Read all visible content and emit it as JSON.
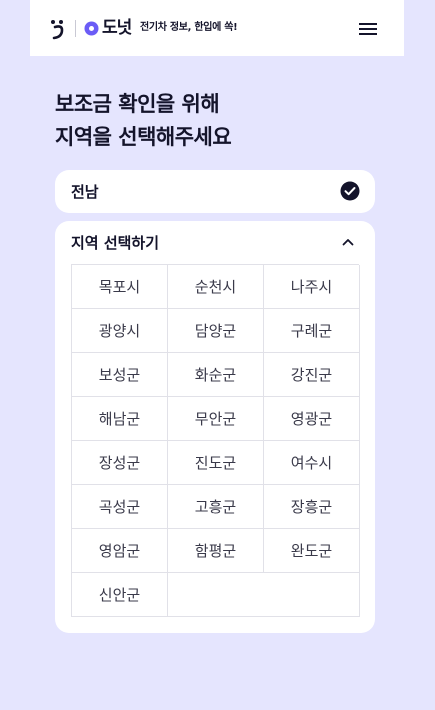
{
  "header": {
    "brand_name": "도넛",
    "slogan": "전기차 정보, 한입에 쏙!",
    "logo_icon": "donut-logo-icon",
    "menu_icon": "hamburger-menu-icon"
  },
  "page": {
    "title_line1": "보조금 확인을 위해",
    "title_line2": "지역을 선택해주세요"
  },
  "province": {
    "selected": "전남",
    "icon": "check-circle-icon"
  },
  "region_select": {
    "title": "지역 선택하기",
    "expanded": true,
    "chevron_icon": "chevron-up-icon",
    "regions": [
      "목포시",
      "순천시",
      "나주시",
      "광양시",
      "담양군",
      "구례군",
      "보성군",
      "화순군",
      "강진군",
      "해남군",
      "무안군",
      "영광군",
      "장성군",
      "진도군",
      "여수시",
      "곡성군",
      "고흥군",
      "장흥군",
      "영암군",
      "함평군",
      "완도군",
      "신안군"
    ]
  },
  "colors": {
    "background": "#e5e5fe",
    "card": "#ffffff",
    "text_dark": "#14142b",
    "accent": "#6b5cf6"
  }
}
